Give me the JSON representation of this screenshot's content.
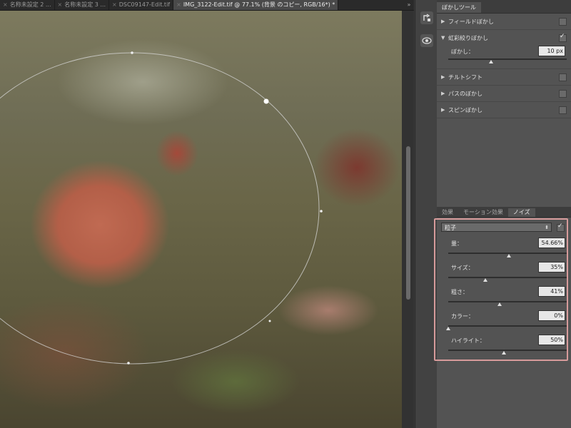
{
  "tabs": [
    {
      "label": "名称未設定 2 ...",
      "active": false
    },
    {
      "label": "名称未設定 3 ...",
      "active": false
    },
    {
      "label": "DSC09147-Edit.tif",
      "active": false
    },
    {
      "label": "IMG_3122-Edit.tif @ 77.1% (背景 のコピー, RGB/16*) *",
      "active": true
    }
  ],
  "tab_overflow": "»",
  "close_glyph": "×",
  "blur_panel": {
    "tab_label": "ぼかしツール",
    "items": [
      {
        "label": "フィールドぼかし",
        "expanded": false,
        "checked": false
      },
      {
        "label": "虹彩絞りぼかし",
        "expanded": true,
        "checked": true
      },
      {
        "label": "チルトシフト",
        "expanded": false,
        "checked": false
      },
      {
        "label": "パスのぼかし",
        "expanded": false,
        "checked": false
      },
      {
        "label": "スピンぼかし",
        "expanded": false,
        "checked": false
      }
    ],
    "blur_param": {
      "label": "ぼかし：",
      "value": "10 px",
      "level": 0.35
    }
  },
  "effects_panel": {
    "tabs": [
      {
        "label": "効果",
        "active": false
      },
      {
        "label": "モーション効果",
        "active": false
      },
      {
        "label": "ノイズ",
        "active": true
      }
    ],
    "noise_type": "粒子",
    "noise_checked": true,
    "params": [
      {
        "label": "量：",
        "value": "54.66%",
        "level": 0.55
      },
      {
        "label": "サイズ：",
        "value": "35%",
        "level": 0.35
      },
      {
        "label": "粗さ：",
        "value": "41%",
        "level": 0.45
      },
      {
        "label": "カラー：",
        "value": "0%",
        "level": 0.0
      },
      {
        "label": "ハイライト：",
        "value": "50%",
        "level": 0.5
      }
    ]
  }
}
